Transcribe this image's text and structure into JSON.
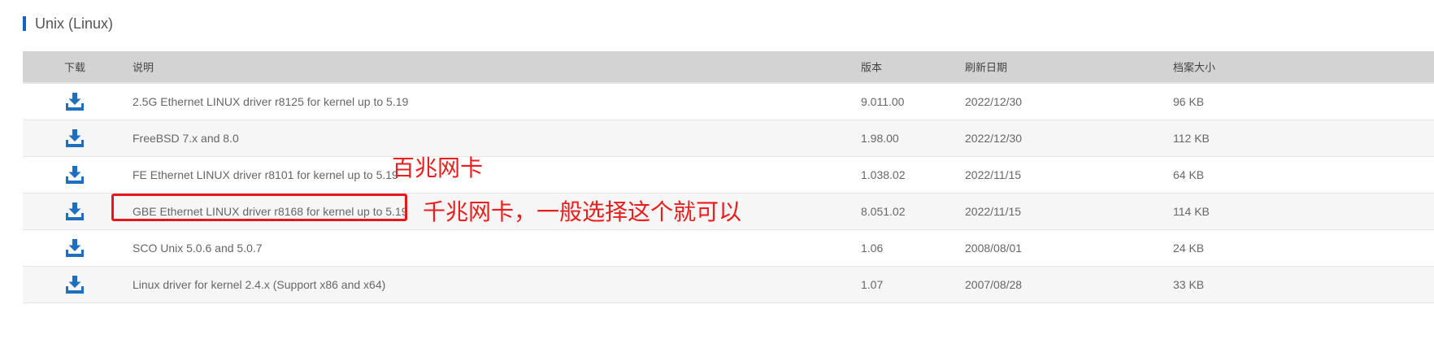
{
  "section": {
    "title": "Unix (Linux)"
  },
  "table": {
    "headers": {
      "download": "下载",
      "description": "说明",
      "version": "版本",
      "date": "刷新日期",
      "size": "档案大小"
    },
    "rows": [
      {
        "description": "2.5G Ethernet LINUX driver r8125 for kernel up to 5.19",
        "version": "9.011.00",
        "date": "2022/12/30",
        "size": "96 KB"
      },
      {
        "description": "FreeBSD 7.x and 8.0",
        "version": "1.98.00",
        "date": "2022/12/30",
        "size": "112 KB"
      },
      {
        "description": "FE Ethernet LINUX driver r8101 for kernel up to 5.19",
        "version": "1.038.02",
        "date": "2022/11/15",
        "size": "64 KB"
      },
      {
        "description": "GBE Ethernet LINUX driver r8168 for kernel up to 5.19",
        "version": "8.051.02",
        "date": "2022/11/15",
        "size": "114 KB"
      },
      {
        "description": "SCO Unix 5.0.6 and 5.0.7",
        "version": "1.06",
        "date": "2008/08/01",
        "size": "24 KB"
      },
      {
        "description": "Linux driver for kernel 2.4.x (Support x86 and x64)",
        "version": "1.07",
        "date": "2007/08/28",
        "size": "33 KB"
      }
    ]
  },
  "annotations": {
    "fast_ethernet_note": "百兆网卡",
    "gigabit_note": "千兆网卡，一般选择这个就可以"
  },
  "icons": {
    "download": "download-tray-icon"
  },
  "colors": {
    "accent": "#1565c0",
    "icon": "#1e6fc0",
    "annotation": "#ee1c1c",
    "header_bg": "#d3d3d3",
    "alt_row_bg": "#f6f6f6"
  }
}
